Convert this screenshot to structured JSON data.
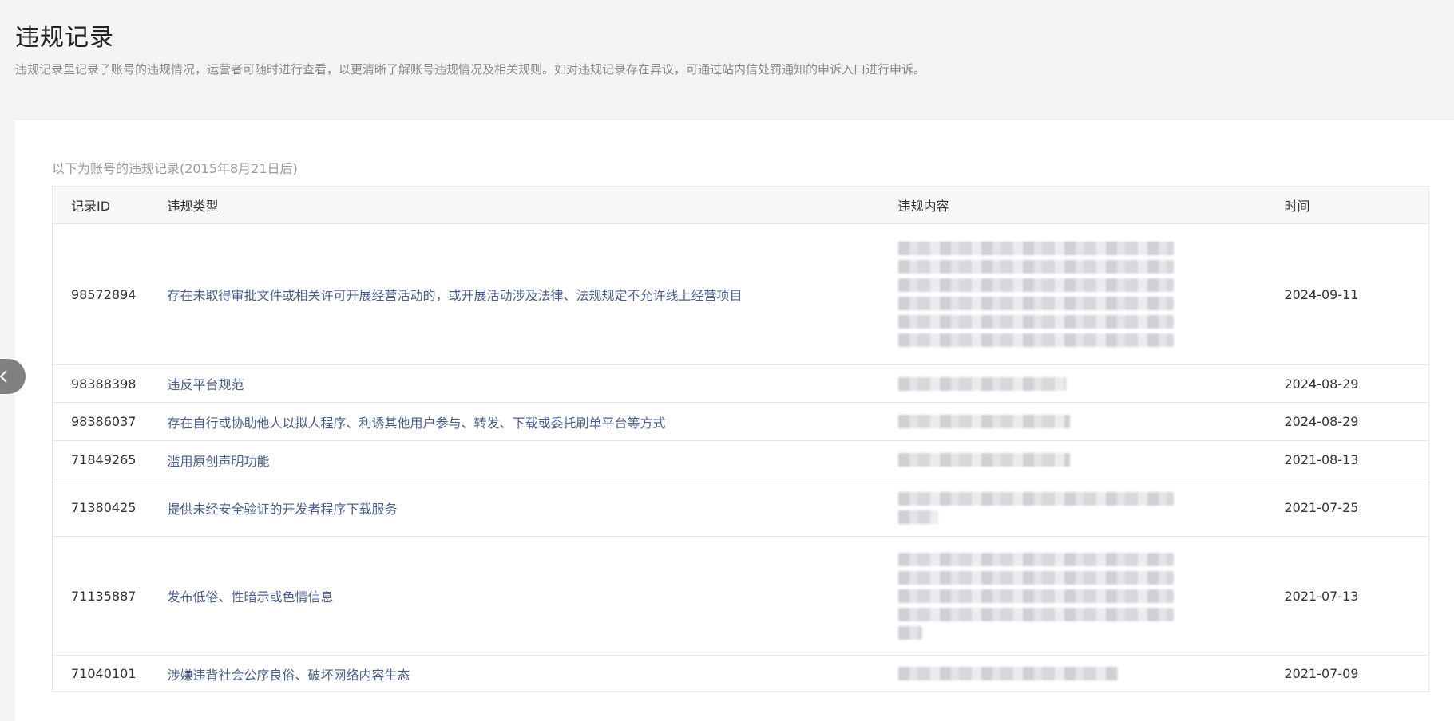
{
  "page": {
    "title": "违规记录",
    "description": "违规记录里记录了账号的违规情况，运营者可随时进行查看，以更清晰了解账号违规情况及相关规则。如对违规记录存在异议，可通过站内信处罚通知的申诉入口进行申诉。"
  },
  "section": {
    "caption": "以下为账号的违规记录(2015年8月21日后)"
  },
  "table": {
    "headers": [
      "记录ID",
      "违规类型",
      "违规内容",
      "时间"
    ],
    "rows": [
      {
        "id": "98572894",
        "type": "存在未取得审批文件或相关许可开展经营活动的，或开展活动涉及法律、法规规定不允许线上经营项目",
        "time": "2024-09-11"
      },
      {
        "id": "98388398",
        "type": "违反平台规范",
        "time": "2024-08-29"
      },
      {
        "id": "98386037",
        "type": "存在自行或协助他人以拟人程序、利诱其他用户参与、转发、下载或委托刷单平台等方式",
        "time": "2024-08-29"
      },
      {
        "id": "71849265",
        "type": "滥用原创声明功能",
        "time": "2021-08-13"
      },
      {
        "id": "71380425",
        "type": "提供未经安全验证的开发者程序下载服务",
        "time": "2021-07-25"
      },
      {
        "id": "71135887",
        "type": "发布低俗、性暗示或色情信息",
        "time": "2021-07-13"
      },
      {
        "id": "71040101",
        "type": "涉嫌违背社会公序良俗、破坏网络内容生态",
        "time": "2021-07-09"
      }
    ]
  },
  "icons": {
    "nav_left": "chevron-left-icon"
  }
}
